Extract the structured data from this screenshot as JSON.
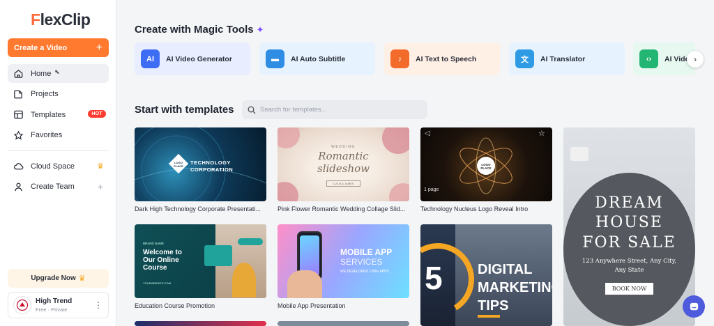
{
  "brand": {
    "name_prefix": "F",
    "name_rest": "lexClip"
  },
  "sidebar": {
    "create_label": "Create a Video",
    "items": [
      {
        "label": "Home",
        "icon": "home-icon"
      },
      {
        "label": "Projects",
        "icon": "folder-icon"
      },
      {
        "label": "Templates",
        "icon": "templates-icon",
        "badge": "HOT"
      },
      {
        "label": "Favorites",
        "icon": "star-icon"
      }
    ],
    "items2": [
      {
        "label": "Cloud Space",
        "icon": "cloud-icon"
      },
      {
        "label": "Create Team",
        "icon": "team-icon"
      }
    ],
    "upgrade_label": "Upgrade Now",
    "user": {
      "name": "High Trend",
      "meta": "Free · Private"
    }
  },
  "magic": {
    "title": "Create with Magic Tools",
    "tools": [
      {
        "label": "AI Video Generator",
        "bg": "#e8edff",
        "icon_bg": "#3d6cf5",
        "glyph": "AI"
      },
      {
        "label": "AI Auto Subtitle",
        "bg": "#e6f3ff",
        "icon_bg": "#2f8de4",
        "glyph": "▬"
      },
      {
        "label": "AI Text to Speech",
        "bg": "#fff0e6",
        "icon_bg": "#f26b2a",
        "glyph": "♪"
      },
      {
        "label": "AI Translator",
        "bg": "#e6f3ff",
        "icon_bg": "#2f9be4",
        "glyph": "文"
      },
      {
        "label": "AI Vide",
        "bg": "#e6f8ef",
        "icon_bg": "#22b573",
        "glyph": "‹›"
      }
    ]
  },
  "templates": {
    "title": "Start with templates",
    "search_placeholder": "Search for templates...",
    "cards": [
      {
        "caption": "Dark High Technology Corporate Presentati...",
        "overlay1": "TECHNOLOGY",
        "overlay2": "CORPORATION",
        "logo": "LOGO PLACE"
      },
      {
        "caption": "Pink Flower Romantic Wedding Collage Slid...",
        "overlay0": "WEDDING",
        "overlay1": "Romantic",
        "overlay2": "slideshow",
        "overlay3": "LUCIA & JAMES"
      },
      {
        "caption": "Technology Nucleus Logo Reveal Intro",
        "logo": "LOGO PLACE",
        "page_count": "1 page"
      },
      {
        "caption": "Education Course Promotion",
        "overlay0": "BRAND NAME",
        "overlay1": "Welcome to",
        "overlay2": "Our Online",
        "overlay3": "Course",
        "footer": "YOURWEBSITE.COM"
      },
      {
        "caption": "Mobile App Presentation",
        "overlay1": "MOBILE APP",
        "overlay2": "SERVICES",
        "overlay3": "WE DEVELOPED 1200+ APPS"
      },
      {
        "caption": "",
        "overlay0": "5",
        "overlay1": "DIGITAL",
        "overlay2": "MARKETING",
        "overlay3": "TIPS"
      },
      {
        "caption": "",
        "overlay1": "DREAM",
        "overlay2": "HOUSE",
        "overlay3": "FOR SALE",
        "address": "123 Anywhere Street, Any City, Any State",
        "button": "BOOK NOW"
      }
    ]
  }
}
